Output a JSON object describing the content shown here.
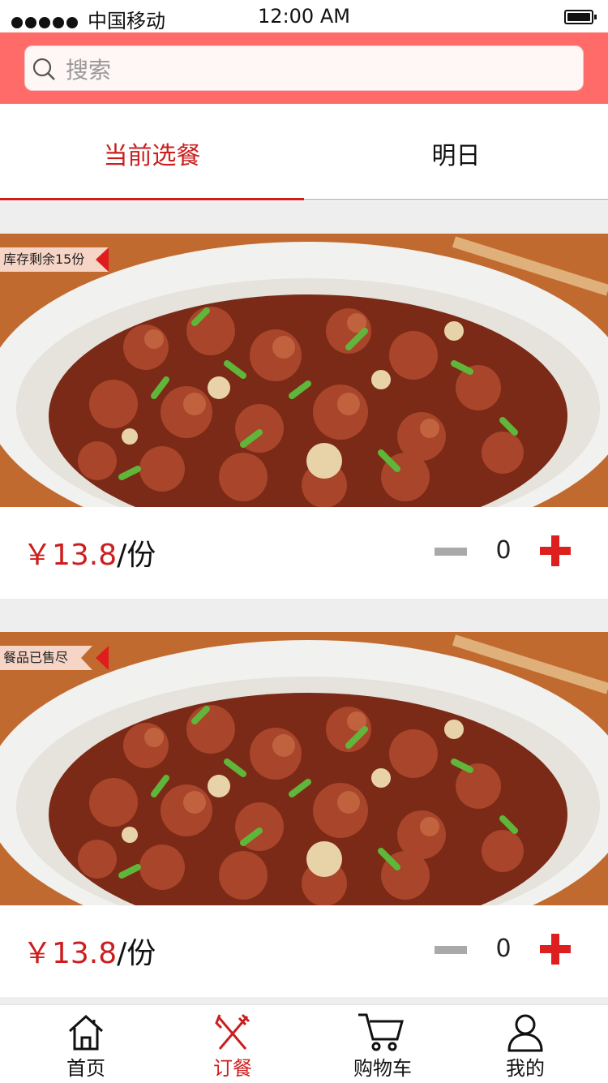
{
  "status_bar": {
    "carrier": "中国移动",
    "time": "12:00 AM"
  },
  "search": {
    "placeholder": "搜索"
  },
  "tabs": [
    {
      "label": "当前选餐",
      "active": true
    },
    {
      "label": "明日",
      "active": false
    }
  ],
  "meals": [
    {
      "badge": "库存剩余15份",
      "price": "￥13.8",
      "unit": "/份",
      "quantity": "0"
    },
    {
      "badge": "餐品已售尽",
      "price": "￥13.8",
      "unit": "/份",
      "quantity": "0"
    }
  ],
  "bottom_nav": [
    {
      "label": "首页",
      "icon": "home-icon",
      "active": false
    },
    {
      "label": "订餐",
      "icon": "fork-knife-icon",
      "active": true
    },
    {
      "label": "购物车",
      "icon": "cart-icon",
      "active": false
    },
    {
      "label": "我的",
      "icon": "user-icon",
      "active": false
    }
  ],
  "colors": {
    "accent": "#cc1e1e",
    "header": "#ff6b68",
    "plus": "#dd1f1f",
    "minus": "#a9a9a9"
  }
}
